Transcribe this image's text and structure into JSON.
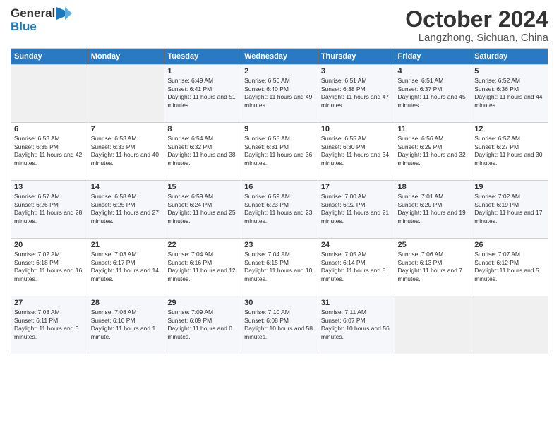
{
  "logo": {
    "line1": "General",
    "line2": "Blue"
  },
  "title": "October 2024",
  "subtitle": "Langzhong, Sichuan, China",
  "days_header": [
    "Sunday",
    "Monday",
    "Tuesday",
    "Wednesday",
    "Thursday",
    "Friday",
    "Saturday"
  ],
  "weeks": [
    [
      {
        "day": "",
        "empty": true
      },
      {
        "day": "",
        "empty": true
      },
      {
        "day": "1",
        "sunrise": "Sunrise: 6:49 AM",
        "sunset": "Sunset: 6:41 PM",
        "daylight": "Daylight: 11 hours and 51 minutes."
      },
      {
        "day": "2",
        "sunrise": "Sunrise: 6:50 AM",
        "sunset": "Sunset: 6:40 PM",
        "daylight": "Daylight: 11 hours and 49 minutes."
      },
      {
        "day": "3",
        "sunrise": "Sunrise: 6:51 AM",
        "sunset": "Sunset: 6:38 PM",
        "daylight": "Daylight: 11 hours and 47 minutes."
      },
      {
        "day": "4",
        "sunrise": "Sunrise: 6:51 AM",
        "sunset": "Sunset: 6:37 PM",
        "daylight": "Daylight: 11 hours and 45 minutes."
      },
      {
        "day": "5",
        "sunrise": "Sunrise: 6:52 AM",
        "sunset": "Sunset: 6:36 PM",
        "daylight": "Daylight: 11 hours and 44 minutes."
      }
    ],
    [
      {
        "day": "6",
        "sunrise": "Sunrise: 6:53 AM",
        "sunset": "Sunset: 6:35 PM",
        "daylight": "Daylight: 11 hours and 42 minutes."
      },
      {
        "day": "7",
        "sunrise": "Sunrise: 6:53 AM",
        "sunset": "Sunset: 6:33 PM",
        "daylight": "Daylight: 11 hours and 40 minutes."
      },
      {
        "day": "8",
        "sunrise": "Sunrise: 6:54 AM",
        "sunset": "Sunset: 6:32 PM",
        "daylight": "Daylight: 11 hours and 38 minutes."
      },
      {
        "day": "9",
        "sunrise": "Sunrise: 6:55 AM",
        "sunset": "Sunset: 6:31 PM",
        "daylight": "Daylight: 11 hours and 36 minutes."
      },
      {
        "day": "10",
        "sunrise": "Sunrise: 6:55 AM",
        "sunset": "Sunset: 6:30 PM",
        "daylight": "Daylight: 11 hours and 34 minutes."
      },
      {
        "day": "11",
        "sunrise": "Sunrise: 6:56 AM",
        "sunset": "Sunset: 6:29 PM",
        "daylight": "Daylight: 11 hours and 32 minutes."
      },
      {
        "day": "12",
        "sunrise": "Sunrise: 6:57 AM",
        "sunset": "Sunset: 6:27 PM",
        "daylight": "Daylight: 11 hours and 30 minutes."
      }
    ],
    [
      {
        "day": "13",
        "sunrise": "Sunrise: 6:57 AM",
        "sunset": "Sunset: 6:26 PM",
        "daylight": "Daylight: 11 hours and 28 minutes."
      },
      {
        "day": "14",
        "sunrise": "Sunrise: 6:58 AM",
        "sunset": "Sunset: 6:25 PM",
        "daylight": "Daylight: 11 hours and 27 minutes."
      },
      {
        "day": "15",
        "sunrise": "Sunrise: 6:59 AM",
        "sunset": "Sunset: 6:24 PM",
        "daylight": "Daylight: 11 hours and 25 minutes."
      },
      {
        "day": "16",
        "sunrise": "Sunrise: 6:59 AM",
        "sunset": "Sunset: 6:23 PM",
        "daylight": "Daylight: 11 hours and 23 minutes."
      },
      {
        "day": "17",
        "sunrise": "Sunrise: 7:00 AM",
        "sunset": "Sunset: 6:22 PM",
        "daylight": "Daylight: 11 hours and 21 minutes."
      },
      {
        "day": "18",
        "sunrise": "Sunrise: 7:01 AM",
        "sunset": "Sunset: 6:20 PM",
        "daylight": "Daylight: 11 hours and 19 minutes."
      },
      {
        "day": "19",
        "sunrise": "Sunrise: 7:02 AM",
        "sunset": "Sunset: 6:19 PM",
        "daylight": "Daylight: 11 hours and 17 minutes."
      }
    ],
    [
      {
        "day": "20",
        "sunrise": "Sunrise: 7:02 AM",
        "sunset": "Sunset: 6:18 PM",
        "daylight": "Daylight: 11 hours and 16 minutes."
      },
      {
        "day": "21",
        "sunrise": "Sunrise: 7:03 AM",
        "sunset": "Sunset: 6:17 PM",
        "daylight": "Daylight: 11 hours and 14 minutes."
      },
      {
        "day": "22",
        "sunrise": "Sunrise: 7:04 AM",
        "sunset": "Sunset: 6:16 PM",
        "daylight": "Daylight: 11 hours and 12 minutes."
      },
      {
        "day": "23",
        "sunrise": "Sunrise: 7:04 AM",
        "sunset": "Sunset: 6:15 PM",
        "daylight": "Daylight: 11 hours and 10 minutes."
      },
      {
        "day": "24",
        "sunrise": "Sunrise: 7:05 AM",
        "sunset": "Sunset: 6:14 PM",
        "daylight": "Daylight: 11 hours and 8 minutes."
      },
      {
        "day": "25",
        "sunrise": "Sunrise: 7:06 AM",
        "sunset": "Sunset: 6:13 PM",
        "daylight": "Daylight: 11 hours and 7 minutes."
      },
      {
        "day": "26",
        "sunrise": "Sunrise: 7:07 AM",
        "sunset": "Sunset: 6:12 PM",
        "daylight": "Daylight: 11 hours and 5 minutes."
      }
    ],
    [
      {
        "day": "27",
        "sunrise": "Sunrise: 7:08 AM",
        "sunset": "Sunset: 6:11 PM",
        "daylight": "Daylight: 11 hours and 3 minutes."
      },
      {
        "day": "28",
        "sunrise": "Sunrise: 7:08 AM",
        "sunset": "Sunset: 6:10 PM",
        "daylight": "Daylight: 11 hours and 1 minute."
      },
      {
        "day": "29",
        "sunrise": "Sunrise: 7:09 AM",
        "sunset": "Sunset: 6:09 PM",
        "daylight": "Daylight: 11 hours and 0 minutes."
      },
      {
        "day": "30",
        "sunrise": "Sunrise: 7:10 AM",
        "sunset": "Sunset: 6:08 PM",
        "daylight": "Daylight: 10 hours and 58 minutes."
      },
      {
        "day": "31",
        "sunrise": "Sunrise: 7:11 AM",
        "sunset": "Sunset: 6:07 PM",
        "daylight": "Daylight: 10 hours and 56 minutes."
      },
      {
        "day": "",
        "empty": true
      },
      {
        "day": "",
        "empty": true
      }
    ]
  ]
}
